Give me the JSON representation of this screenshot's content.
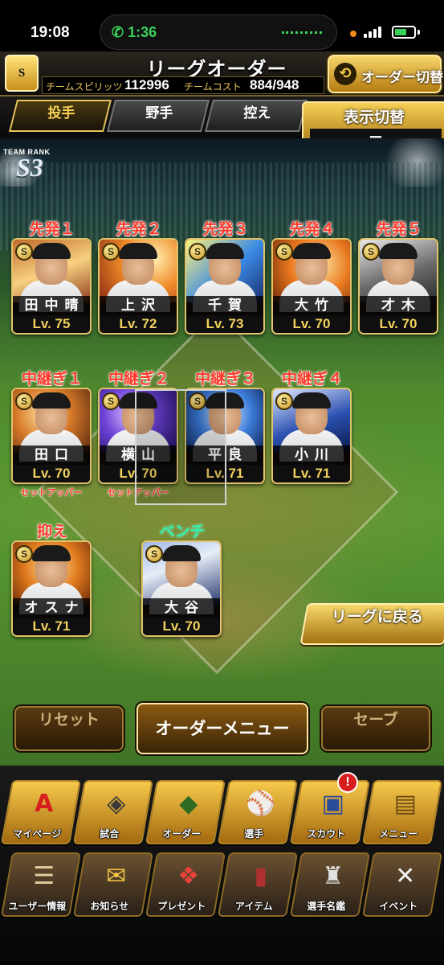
{
  "status_bar": {
    "time": "19:08",
    "call_timer": "1:36"
  },
  "header": {
    "title": "リーグオーダー",
    "team_spirits_label": "チームスピリッツ",
    "team_spirits_value": "112996",
    "team_cost_label": "チームコスト",
    "team_cost_value": "884/948",
    "order_switch_label": "オーダー切替",
    "logo_text": "S"
  },
  "tabs": [
    {
      "label": "投手",
      "active": true
    },
    {
      "label": "野手",
      "active": false
    },
    {
      "label": "控え",
      "active": false
    }
  ],
  "view_toggle": {
    "label": "表示切替",
    "value": "ー"
  },
  "team_rank": {
    "caption": "TEAM RANK",
    "value": "S3"
  },
  "starters": [
    {
      "slot": "先発１",
      "name": "田中晴",
      "level": "Lv. 75"
    },
    {
      "slot": "先発２",
      "name": "上沢",
      "level": "Lv. 72"
    },
    {
      "slot": "先発３",
      "name": "千賀",
      "level": "Lv. 73"
    },
    {
      "slot": "先発４",
      "name": "大竹",
      "level": "Lv. 70"
    },
    {
      "slot": "先発５",
      "name": "才木",
      "level": "Lv. 70"
    }
  ],
  "relievers": [
    {
      "slot": "中継ぎ１",
      "name": "田口",
      "level": "Lv. 70",
      "role": "セットアッパー"
    },
    {
      "slot": "中継ぎ２",
      "name": "横山",
      "level": "Lv. 70",
      "role": "セットアッパー"
    },
    {
      "slot": "中継ぎ３",
      "name": "平良",
      "level": "Lv. 71",
      "role": ""
    },
    {
      "slot": "中継ぎ４",
      "name": "小川",
      "level": "Lv. 71",
      "role": ""
    }
  ],
  "closer": {
    "slot": "抑え",
    "name": "オスナ",
    "level": "Lv. 71"
  },
  "bench": {
    "slot": "ベンチ",
    "name": "大谷",
    "level": "Lv. 70"
  },
  "buttons": {
    "return_to_league": "リーグに戻る",
    "reset": "リセット",
    "order_menu": "オーダーメニュー",
    "save": "セーブ"
  },
  "menu_top": [
    {
      "label": "マイページ",
      "icon": "mypage-icon"
    },
    {
      "label": "試合",
      "icon": "stadium-icon"
    },
    {
      "label": "オーダー",
      "icon": "field-icon"
    },
    {
      "label": "選手",
      "icon": "player-icon"
    },
    {
      "label": "スカウト",
      "icon": "scout-icon"
    },
    {
      "label": "メニュー",
      "icon": "menu-icon"
    }
  ],
  "menu_bottom": [
    {
      "label": "ユーザー情報",
      "icon": "user-info-icon"
    },
    {
      "label": "お知らせ",
      "icon": "notice-icon"
    },
    {
      "label": "プレゼント",
      "icon": "gift-icon"
    },
    {
      "label": "アイテム",
      "icon": "item-icon"
    },
    {
      "label": "選手名鑑",
      "icon": "directory-icon"
    },
    {
      "label": "イベント",
      "icon": "event-icon"
    }
  ],
  "scout_badge": "!",
  "colors": {
    "gold": "#e8c45a",
    "slot_red": "#ff3b2b",
    "bench_green": "#3af0b0",
    "level_text": "#f2d25e"
  }
}
